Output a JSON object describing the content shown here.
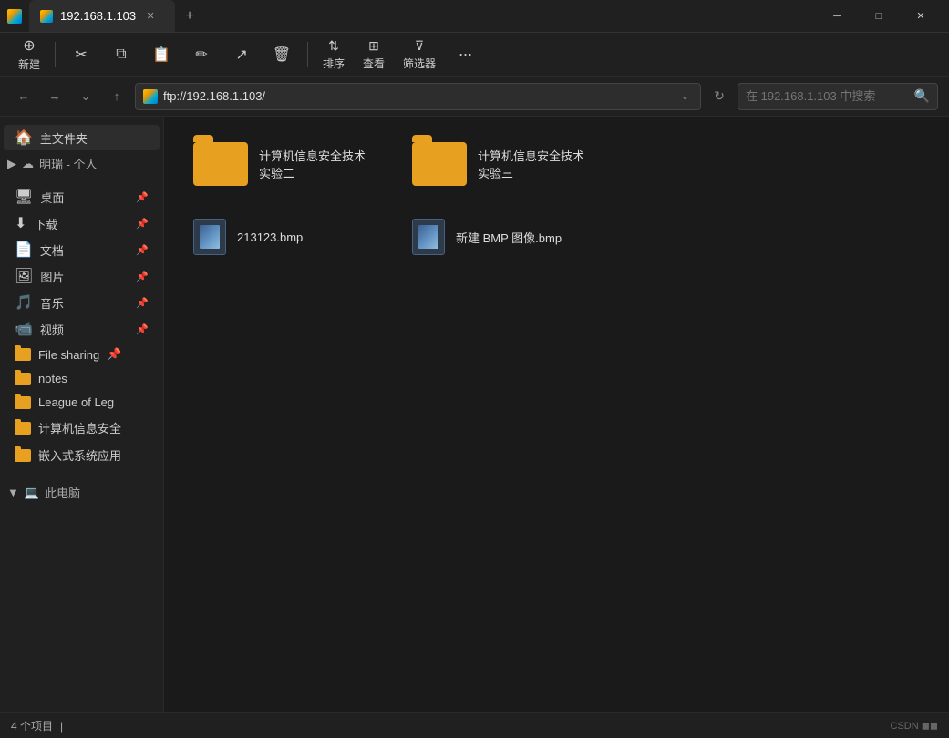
{
  "titleBar": {
    "tabTitle": "192.168.1.103",
    "newTabLabel": "+",
    "minimizeIcon": "─",
    "maximizeIcon": "□",
    "closeIcon": "✕"
  },
  "toolbar": {
    "newLabel": "新建",
    "cutIcon": "✂",
    "copyIcon": "⧉",
    "pasteIcon": "📋",
    "renameIcon": "✏",
    "shareIcon": "↗",
    "deleteIcon": "🗑",
    "sortLabel": "排序",
    "viewLabel": "查看",
    "filterLabel": "筛选器",
    "moreIcon": "···"
  },
  "addressBar": {
    "url": "ftp://192.168.1.103/",
    "searchPlaceholder": "在 192.168.1.103 中搜索"
  },
  "sidebar": {
    "homeLabel": "主文件夹",
    "cloudLabel": "明瑞 - 个人",
    "items": [
      {
        "label": "桌面",
        "icon": "🖥"
      },
      {
        "label": "下载",
        "icon": "⬇"
      },
      {
        "label": "文档",
        "icon": "📄"
      },
      {
        "label": "图片",
        "icon": "🖼"
      },
      {
        "label": "音乐",
        "icon": "🎵"
      },
      {
        "label": "视频",
        "icon": "📹"
      }
    ],
    "folders": [
      {
        "label": "File sharing"
      },
      {
        "label": "notes"
      },
      {
        "label": "League of Leg"
      },
      {
        "label": "计算机信息安全"
      },
      {
        "label": "嵌入式系统应用"
      }
    ],
    "thisPC": "此电脑"
  },
  "content": {
    "folders": [
      {
        "label": "计算机信息安全技术 实验二"
      },
      {
        "label": "计算机信息安全技术 实验三"
      }
    ],
    "files": [
      {
        "label": "213123.bmp"
      },
      {
        "label": "新建 BMP 图像.bmp"
      }
    ]
  },
  "statusBar": {
    "itemCount": "4 个项目",
    "separator": "|"
  }
}
